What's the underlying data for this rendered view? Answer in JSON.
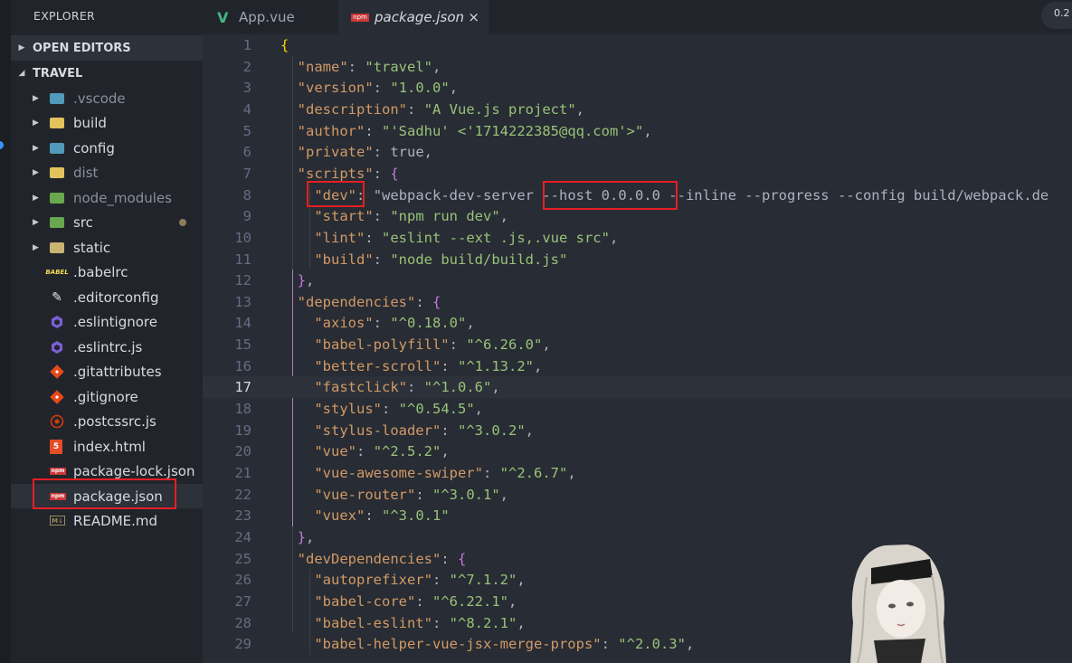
{
  "sidebar": {
    "title": "EXPLORER",
    "open_editors_label": "OPEN EDITORS",
    "project_label": "TRAVEL",
    "items": [
      {
        "label": ".vscode",
        "icon": "folder-vscode-icon"
      },
      {
        "label": "build",
        "icon": "folder-icon"
      },
      {
        "label": "config",
        "icon": "folder-config-icon"
      },
      {
        "label": "dist",
        "icon": "folder-icon"
      },
      {
        "label": "node_modules",
        "icon": "folder-node-icon"
      },
      {
        "label": "src",
        "icon": "folder-src-icon"
      },
      {
        "label": "static",
        "icon": "folder-icon"
      },
      {
        "label": ".babelrc",
        "icon": "babel-icon"
      },
      {
        "label": ".editorconfig",
        "icon": "editorconfig-icon"
      },
      {
        "label": ".eslintignore",
        "icon": "eslint-icon"
      },
      {
        "label": ".eslintrc.js",
        "icon": "eslint-icon"
      },
      {
        "label": ".gitattributes",
        "icon": "git-icon"
      },
      {
        "label": ".gitignore",
        "icon": "git-icon"
      },
      {
        "label": ".postcssrc.js",
        "icon": "postcss-icon"
      },
      {
        "label": "index.html",
        "icon": "html5-icon"
      },
      {
        "label": "package-lock.json",
        "icon": "npm-icon"
      },
      {
        "label": "package.json",
        "icon": "npm-icon"
      },
      {
        "label": "README.md",
        "icon": "markdown-icon"
      }
    ]
  },
  "tabs": [
    {
      "label": "App.vue",
      "icon": "vue-icon"
    },
    {
      "label": "package.json",
      "icon": "npm-icon",
      "close": "×"
    }
  ],
  "status_badge": "0.2",
  "editor": {
    "current_line": 17,
    "line_numbers": [
      "1",
      "2",
      "3",
      "4",
      "5",
      "6",
      "7",
      "8",
      "9",
      "10",
      "11",
      "12",
      "13",
      "14",
      "15",
      "16",
      "17",
      "18",
      "19",
      "20",
      "21",
      "22",
      "23",
      "24",
      "25",
      "26",
      "27",
      "28",
      "29"
    ],
    "lines": [
      "{",
      "  \"name\": \"travel\",",
      "  \"version\": \"1.0.0\",",
      "  \"description\": \"A Vue.js project\",",
      "  \"author\": \"'Sadhu' <'1714222385@qq.com'>\",",
      "  \"private\": true,",
      "  \"scripts\": {",
      "    \"dev\": \"webpack-dev-server --host 0.0.0.0 --inline --progress --config build/webpack.de",
      "    \"start\": \"npm run dev\",",
      "    \"lint\": \"eslint --ext .js,.vue src\",",
      "    \"build\": \"node build/build.js\"",
      "  },",
      "  \"dependencies\": {",
      "    \"axios\": \"^0.18.0\",",
      "    \"babel-polyfill\": \"^6.26.0\",",
      "    \"better-scroll\": \"^1.13.2\",",
      "    \"fastclick\": \"^1.0.6\",",
      "    \"stylus\": \"^0.54.5\",",
      "    \"stylus-loader\": \"^3.0.2\",",
      "    \"vue\": \"^2.5.2\",",
      "    \"vue-awesome-swiper\": \"^2.6.7\",",
      "    \"vue-router\": \"^3.0.1\",",
      "    \"vuex\": \"^3.0.1\"",
      "  },",
      "  \"devDependencies\": {",
      "    \"autoprefixer\": \"^7.1.2\",",
      "    \"babel-core\": \"^6.22.1\",",
      "    \"babel-eslint\": \"^8.2.1\",",
      "    \"babel-helper-vue-jsx-merge-props\": \"^2.0.3\","
    ]
  },
  "colors": {
    "editor_bg": "#282c34",
    "sidebar_bg": "#21252b",
    "string": "#98c379",
    "keyword": "#56b6c2",
    "bracket": "#c678dd",
    "highlight_box": "#e51f24"
  }
}
